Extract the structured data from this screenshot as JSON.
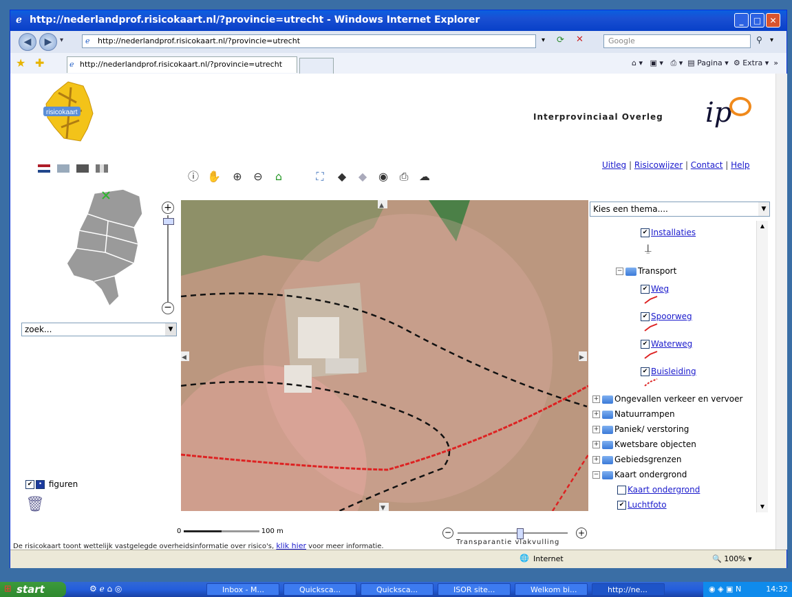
{
  "window": {
    "title": "http://nederlandprof.risicokaart.nl/?provincie=utrecht - Windows Internet Explorer"
  },
  "addressbar": {
    "url": "http://nederlandprof.risicokaart.nl/?provincie=utrecht",
    "search_placeholder": "Google"
  },
  "tabs": {
    "active": "http://nederlandprof.risicokaart.nl/?provincie=utrecht"
  },
  "toolbar": {
    "page_label": "Pagina",
    "extra_label": "Extra"
  },
  "header": {
    "logo_text": "risicokaart",
    "ipo_text": "Interprovinciaal Overleg",
    "ipo_mark": "ip"
  },
  "toplinks": [
    "Uitleg",
    "Risicowijzer",
    "Contact",
    "Help"
  ],
  "search": {
    "value": "zoek..."
  },
  "theme": {
    "value": "Kies een thema...."
  },
  "tree": {
    "installaties": "Installaties",
    "transport": "Transport",
    "weg": "Weg",
    "spoorweg": "Spoorweg",
    "waterweg": "Waterweg",
    "buisleiding": "Buisleiding",
    "groups": [
      "Ongevallen verkeer en vervoer",
      "Natuurrampen",
      "Paniek/ verstoring",
      "Kwetsbare objecten",
      "Gebiedsgrenzen"
    ],
    "kaart_ondergrond": "Kaart ondergrond",
    "sub_kaart": "Kaart ondergrond",
    "luchtfoto": "Luchtfoto"
  },
  "figuren": "figuren",
  "scale": {
    "start": "0",
    "end": "100 m"
  },
  "transparency": {
    "label": "Transparantie vlakvulling",
    "level_fraction": 0.56
  },
  "footer": {
    "text_before": "De risicokaart toont wettelijk vastgelegde overheidsinformatie over risico's,",
    "link": "klik hier",
    "text_after": "voor meer informatie."
  },
  "status": {
    "zone": "Internet",
    "zoom": "100%"
  },
  "taskbar": {
    "start": "start",
    "tasks": [
      "Inbox - M...",
      "Quicksca...",
      "Quicksca...",
      "ISOR site...",
      "Welkom bi...",
      "http://ne..."
    ],
    "clock": "14:32"
  }
}
